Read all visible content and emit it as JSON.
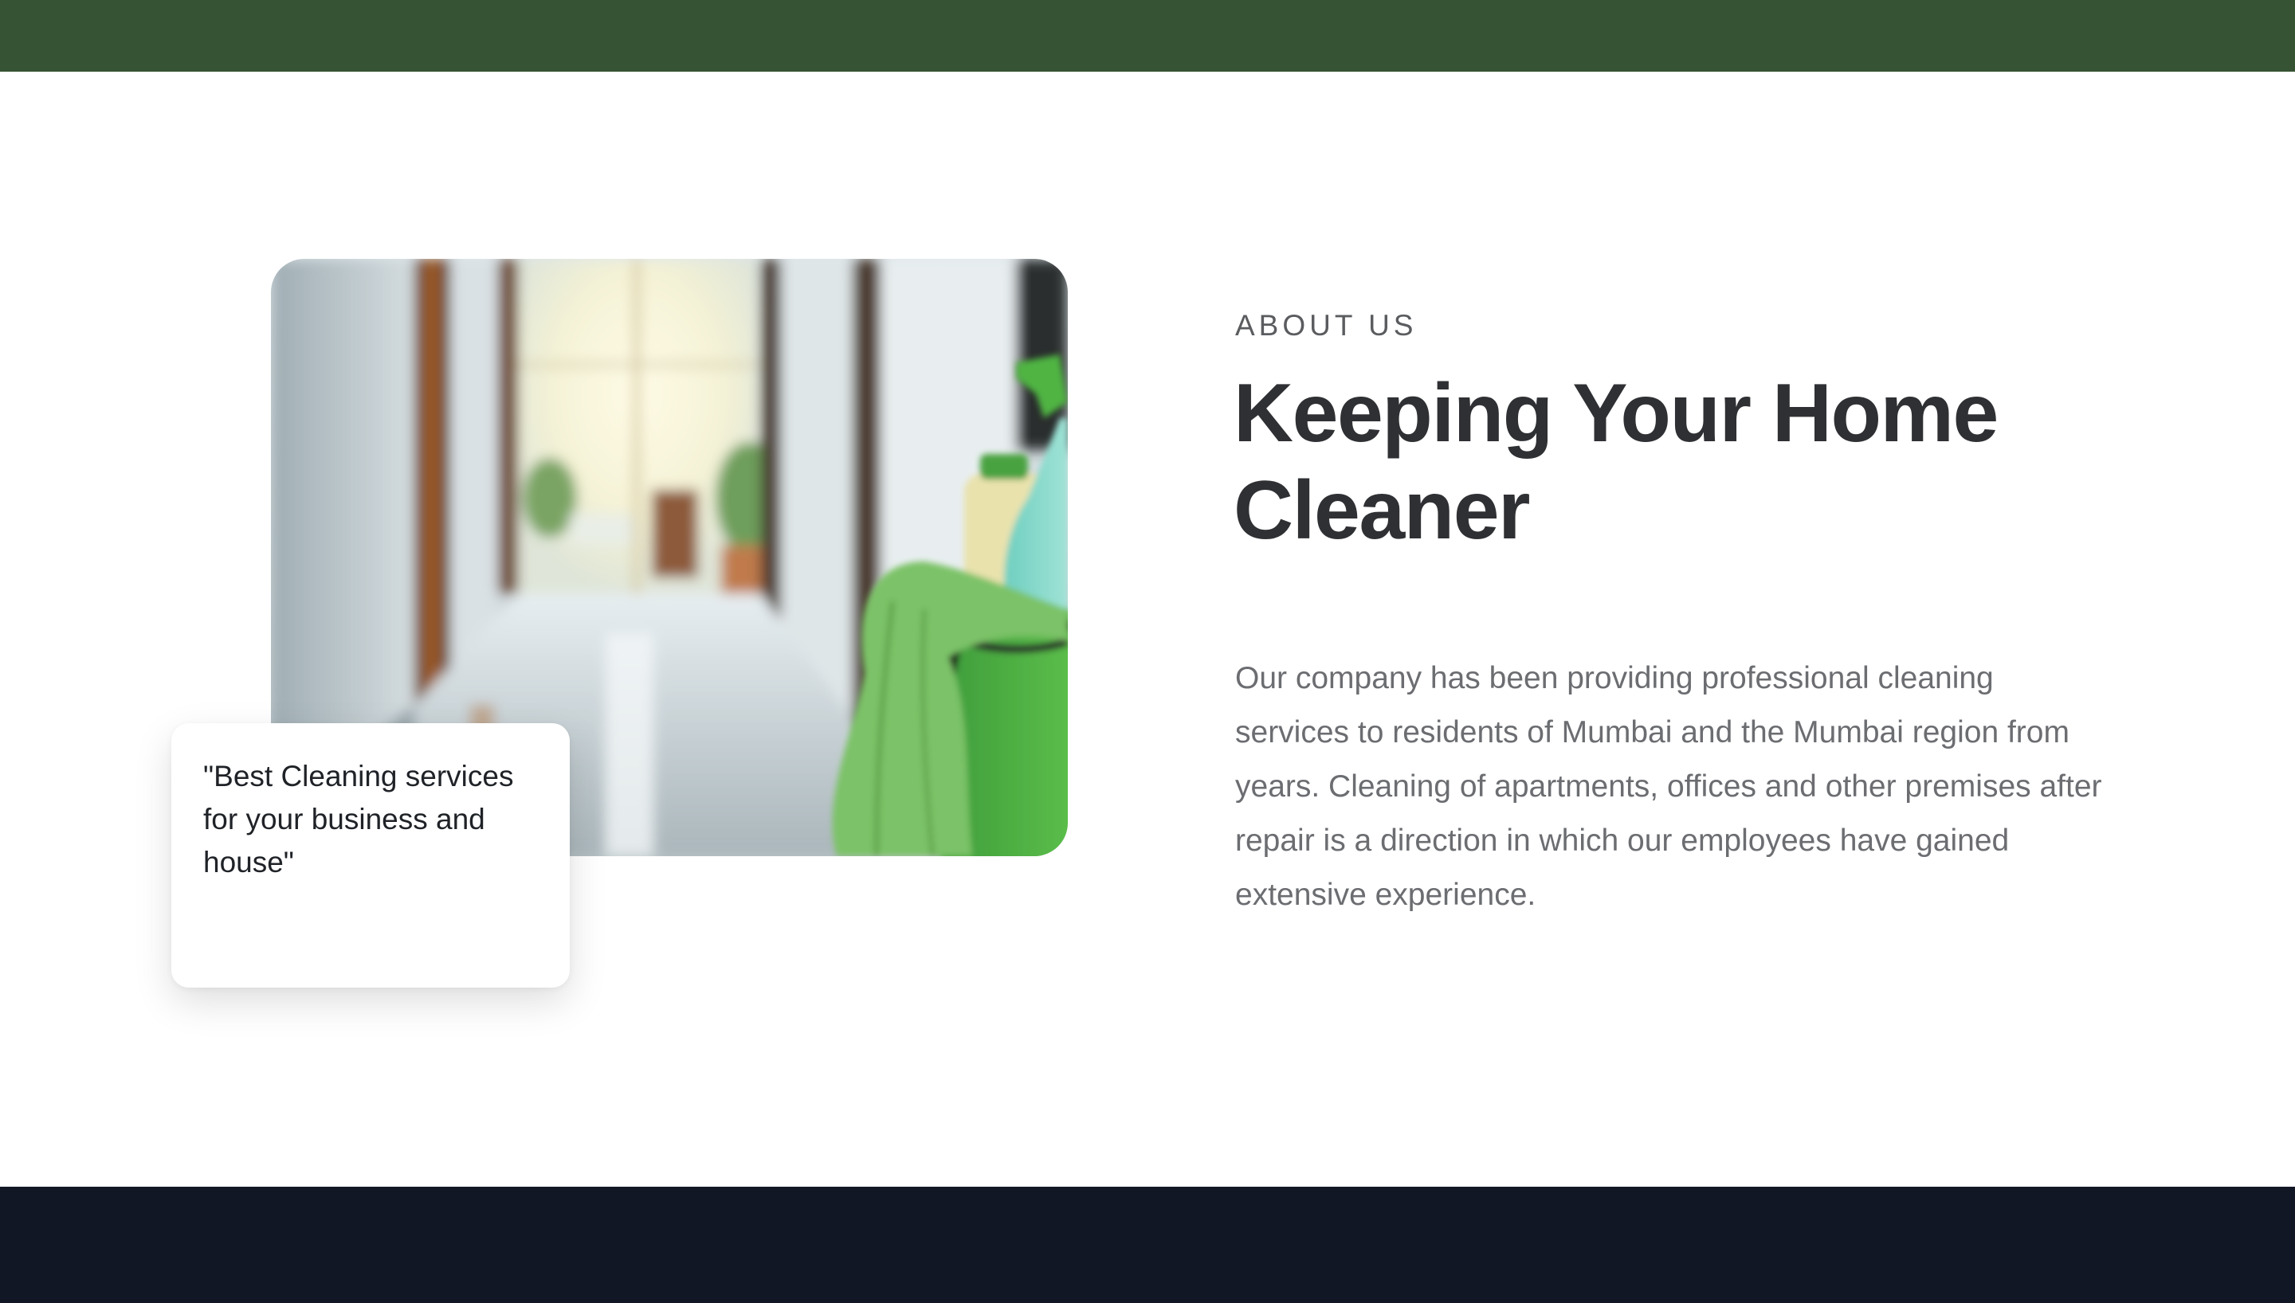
{
  "about": {
    "eyebrow": "ABOUT US",
    "heading": "Keeping Your Home Cleaner",
    "body": "Our company has been providing professional cleaning services to residents of Mumbai and the Mumbai region from years. Cleaning of apartments, offices and other premises after repair is a direction in which our employees have gained extensive experience.",
    "quote": "\"Best Cleaning services for your business and house\""
  },
  "colors": {
    "top_bar": "#365333",
    "footer": "#121726",
    "heading": "#2f3033",
    "body": "#6b6d71"
  }
}
